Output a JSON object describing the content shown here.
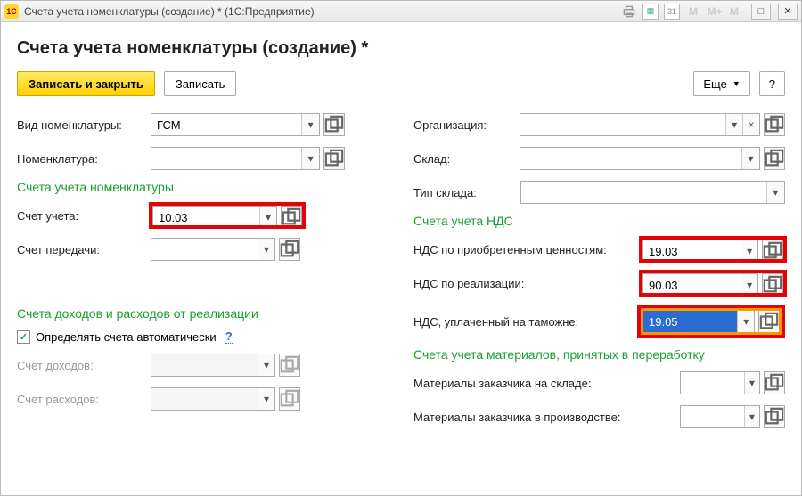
{
  "titlebar": {
    "text": "Счета учета номенклатуры (создание) *   (1С:Предприятие)"
  },
  "header": {
    "title": "Счета учета номенклатуры (создание) *"
  },
  "toolbar": {
    "save_close": "Записать и закрыть",
    "save": "Записать",
    "more": "Еще",
    "help": "?"
  },
  "left": {
    "vidNom_label": "Вид номенклатуры:",
    "vidNom_value": "ГСМ",
    "nomenklatura_label": "Номенклатура:",
    "nomenklatura_value": "",
    "section_accounts": "Счета учета номенклатуры",
    "schetUcheta_label": "Счет учета:",
    "schetUcheta_value": "10.03",
    "schetPeredachi_label": "Счет передачи:",
    "schetPeredachi_value": "",
    "section_income": "Счета доходов и расходов от реализации",
    "autodetect_label": "Определять счета автоматически",
    "autodetect_checked": true,
    "schetDohodov_label": "Счет доходов:",
    "schetRashodov_label": "Счет расходов:"
  },
  "right": {
    "org_label": "Организация:",
    "org_value": "",
    "sklad_label": "Склад:",
    "sklad_value": "",
    "tipSklada_label": "Тип склада:",
    "tipSklada_value": "",
    "section_nds": "Счета учета НДС",
    "ndsPriobr_label": "НДС по приобретенным ценностям:",
    "ndsPriobr_value": "19.03",
    "ndsRealiz_label": "НДС по реализации:",
    "ndsRealiz_value": "90.03",
    "ndsTamozh_label": "НДС, уплаченный на таможне:",
    "ndsTamozh_value": "19.05",
    "section_materials": "Счета учета материалов, принятых в переработку",
    "matSklad_label": "Материалы заказчика на складе:",
    "matSklad_value": "",
    "matProizv_label": "Материалы заказчика в производстве:",
    "matProizv_value": ""
  }
}
